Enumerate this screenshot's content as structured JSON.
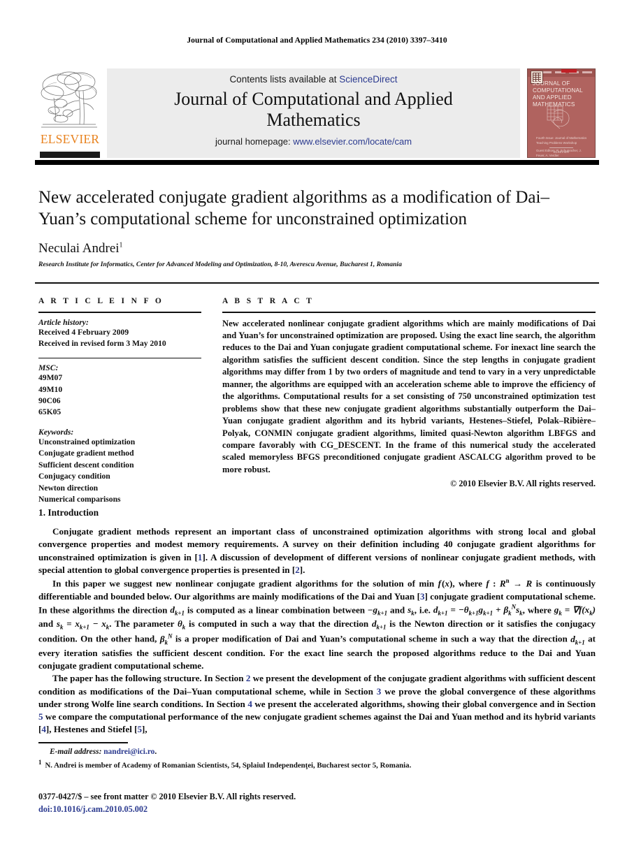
{
  "running_head": "Journal of Computational and Applied Mathematics 234 (2010) 3397–3410",
  "masthead": {
    "contents_prefix": "Contents lists available at ",
    "contents_link": "ScienceDirect",
    "journal_name": "Journal of Computational and Applied Mathematics",
    "homepage_prefix": "journal homepage: ",
    "homepage_link": "www.elsevier.com/locate/cam",
    "publisher_wordmark": "ELSEVIER",
    "cover": {
      "title": "JOURNAL OF COMPUTATIONAL AND APPLIED MATHEMATICS",
      "caption_line1": "Fourth Issue: Journal of Mathematics Teaching Problems Workshop",
      "caption_line2": "Guest Editors: R. Schumacher, J. Feuer, A. Verdier",
      "footer": "ELSEVIER"
    }
  },
  "article": {
    "title": "New accelerated conjugate gradient algorithms as a modification of Dai–Yuan’s computational scheme for unconstrained optimization",
    "author": "Neculai Andrei",
    "author_footnote_mark": "1",
    "affiliation": "Research Institute for Informatics, Center for Advanced Modeling and Optimization, 8-10, Averescu Avenue, Bucharest 1, Romania"
  },
  "article_info": {
    "heading": "A R T I C L E   I N F O",
    "history_label": "Article history:",
    "history": [
      "Received 4 February 2009",
      "Received in revised form 3 May 2010"
    ],
    "msc_label": "MSC:",
    "msc": [
      "49M07",
      "49M10",
      "90C06",
      "65K05"
    ],
    "keywords_label": "Keywords:",
    "keywords": [
      "Unconstrained optimization",
      "Conjugate gradient method",
      "Sufficient descent condition",
      "Conjugacy condition",
      "Newton direction",
      "Numerical comparisons"
    ]
  },
  "abstract": {
    "heading": "A B S T R A C T",
    "text": "New accelerated nonlinear conjugate gradient algorithms which are mainly modifications of Dai and Yuan’s for unconstrained optimization are proposed. Using the exact line search, the algorithm reduces to the Dai and Yuan conjugate gradient computational scheme. For inexact line search the algorithm satisfies the sufficient descent condition. Since the step lengths in conjugate gradient algorithms may differ from 1 by two orders of magnitude and tend to vary in a very unpredictable manner, the algorithms are equipped with an acceleration scheme able to improve the efficiency of the algorithms. Computational results for a set consisting of 750 unconstrained optimization test problems show that these new conjugate gradient algorithms substantially outperform the Dai–Yuan conjugate gradient algorithm and its hybrid variants, Hestenes–Stiefel, Polak–Ribière–Polyak, CONMIN conjugate gradient algorithms, limited quasi-Newton algorithm LBFGS and compare favorably with CG_DESCENT. In the frame of this numerical study the accelerated scaled memoryless BFGS preconditioned conjugate gradient ASCALCG algorithm proved to be more robust.",
    "copyright": "© 2010 Elsevier B.V. All rights reserved."
  },
  "body": {
    "section_heading": "1. Introduction",
    "para1_a": "Conjugate gradient methods represent an important class of unconstrained optimization algorithms with strong local and global convergence properties and modest memory requirements. A survey on their definition including 40 conjugate gradient algorithms for unconstrained optimization is given in [",
    "para1_ref1": "1",
    "para1_b": "]. A discussion of development of different versions of nonlinear conjugate gradient methods, with special attention to global convergence properties is presented in [",
    "para1_ref2": "2",
    "para1_c": "].",
    "para2_a": "In this paper we suggest new nonlinear conjugate gradient algorithms for the solution of min",
    "para2_b": ", where",
    "para2_c": "is continuously differentiable and bounded below. Our algorithms are mainly modifications of the Dai and Yuan [",
    "para2_ref3": "3",
    "para2_d": "] conjugate gradient computational scheme. In these algorithms the direction",
    "para2_e": "is computed as a linear combination between",
    "para2_f": "and",
    "para2_g": ", i.e.",
    "para2_h": ", where",
    "para2_i": "and",
    "para2_j": ". The parameter",
    "para2_k": "is computed in such a way that the direction",
    "para2_l": "is the Newton direction or it satisfies the conjugacy condition. On the other hand,",
    "para2_m": "is a proper modification of Dai and Yuan’s computational scheme in such a way that the direction",
    "para2_n": "at every iteration satisfies the sufficient descent condition. For the exact line search the proposed algorithms reduce to the Dai and Yuan conjugate gradient computational scheme.",
    "para3_a": "The paper has the following structure. In Section ",
    "para3_s2": "2",
    "para3_b": " we present the development of the conjugate gradient algorithms with sufficient descent condition as modifications of the Dai–Yuan computational scheme, while in Section ",
    "para3_s3": "3",
    "para3_c": " we prove the global convergence of these algorithms under strong Wolfe line search conditions. In Section ",
    "para3_s4": "4",
    "para3_d": " we present the accelerated algorithms, showing their global convergence and in Section ",
    "para3_s5": "5",
    "para3_e": " we compare the computational performance of the new conjugate gradient schemes against the Dai and Yuan method and its hybrid variants [",
    "para3_ref4": "4",
    "para3_f": "], Hestenes and Stiefel [",
    "para3_ref5": "5",
    "para3_g": "],"
  },
  "footnote": {
    "email_label": "E-mail address:",
    "email": "nandrei@ici.ro",
    "email_suffix": ".",
    "mark": "1",
    "note": "N. Andrei is member of Academy of Romanian Scientists, 54, Splaiul Independenţei, Bucharest sector 5, Romania."
  },
  "imprint": {
    "issn_line": "0377-0427/$ – see front matter © 2010 Elsevier B.V. All rights reserved.",
    "doi_line": "doi:10.1016/j.cam.2010.05.002"
  },
  "colors": {
    "link": "#2B3A8F",
    "elsevier_orange": "#E8821E",
    "cover_maroon": "#B0635F",
    "rule_black": "#000000"
  }
}
